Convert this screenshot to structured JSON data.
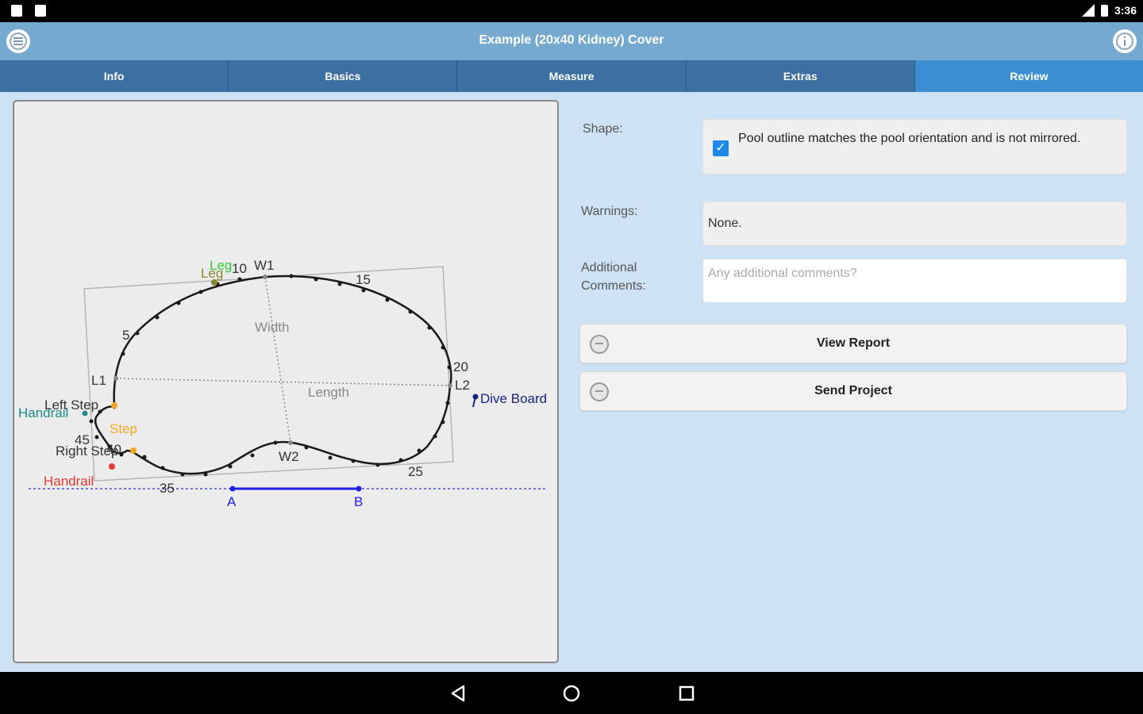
{
  "status": {
    "time": "3:36"
  },
  "title": "Example (20x40 Kidney) Cover",
  "tabs": [
    "Info",
    "Basics",
    "Measure",
    "Extras",
    "Review"
  ],
  "active_tab": "Review",
  "diagram": {
    "labels": {
      "leg_a": "Leg",
      "leg_b": "Leg",
      "n10": "10",
      "w1": "W1",
      "n15": "15",
      "n5": "5",
      "width": "Width",
      "n20": "20",
      "l1": "L1",
      "l2": "L2",
      "length": "Length",
      "dive_board": "Dive Board",
      "left_step": "Left Step",
      "handrail_left": "Handrail",
      "step": "Step",
      "n45": "45",
      "right_step": "Right Step",
      "n40": "40",
      "w2": "W2",
      "n25": "25",
      "handrail_bottom": "Handrail",
      "n35": "35",
      "a": "A",
      "b": "B"
    }
  },
  "form": {
    "shape_label": "Shape:",
    "shape_text": "Pool outline matches the pool orientation and is not mirrored.",
    "shape_checked": true,
    "warnings_label": "Warnings:",
    "warnings_value": "None.",
    "comments_label_1": "Additional",
    "comments_label_2": "Comments:",
    "comments_placeholder": "Any additional comments?",
    "view_report": "View Report",
    "send_project": "Send Project"
  },
  "colors": {
    "titlebar": "#76a9cf",
    "tab": "#3d6fa3",
    "tab_active": "#3d8fd4",
    "content_bg": "#cde3f5",
    "checkbox": "#1e88e5",
    "leg": "#33cc33",
    "step": "#f5a623",
    "handrail": "#e53935",
    "dive_board": "#1a237e",
    "ab": "#1f1fe8"
  }
}
